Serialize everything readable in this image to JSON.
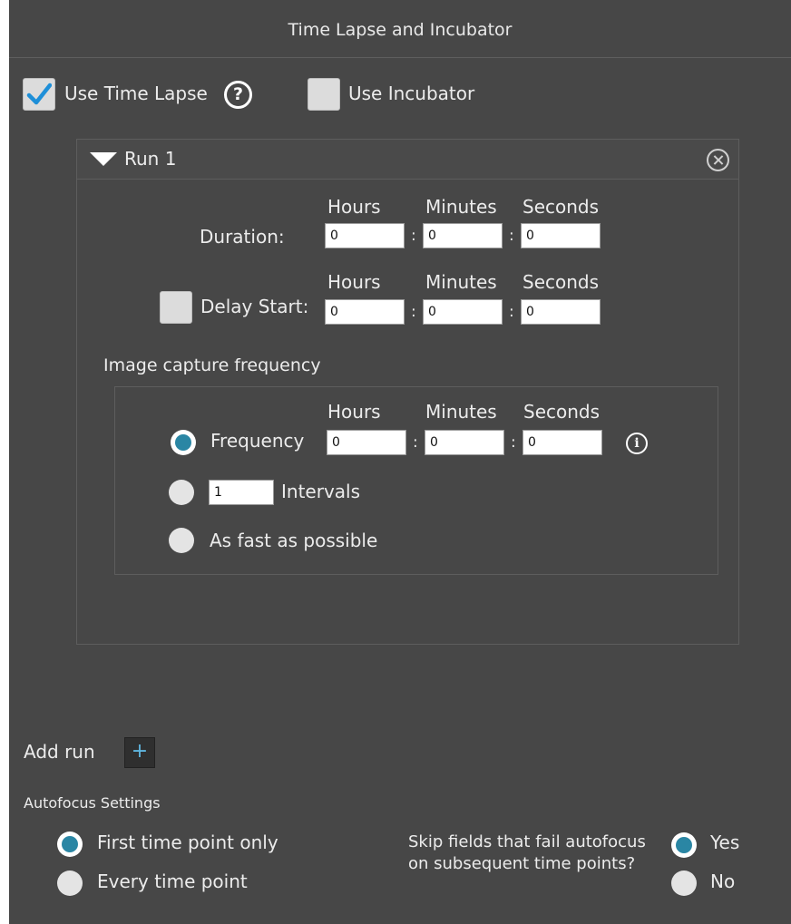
{
  "panel": {
    "title": "Time Lapse and Incubator"
  },
  "options": {
    "use_time_lapse": {
      "label": "Use Time Lapse",
      "checked": true
    },
    "help_icon": "?",
    "use_incubator": {
      "label": "Use Incubator",
      "checked": false
    }
  },
  "run": {
    "title": "Run 1",
    "units": {
      "hours": "Hours",
      "minutes": "Minutes",
      "seconds": "Seconds"
    },
    "duration": {
      "label": "Duration:",
      "hours": "0",
      "minutes": "0",
      "seconds": "0"
    },
    "delay_start": {
      "label": "Delay Start:",
      "checked": false,
      "hours": "0",
      "minutes": "0",
      "seconds": "0"
    },
    "separator": ":",
    "image_capture": {
      "heading": "Image capture frequency",
      "frequency": {
        "label": "Frequency",
        "selected": true,
        "hours": "0",
        "minutes": "0",
        "seconds": "0"
      },
      "info_icon": "i",
      "intervals": {
        "value": "1",
        "label": "Intervals",
        "selected": false
      },
      "fast": {
        "label": "As fast as possible",
        "selected": false
      }
    }
  },
  "add_run": {
    "label": "Add run",
    "button": "+"
  },
  "autofocus": {
    "heading": "Autofocus Settings",
    "first_time_point": {
      "label": "First time point only",
      "selected": true
    },
    "every_time_point": {
      "label": "Every time point",
      "selected": false
    },
    "skip_question": "Skip fields that fail autofocus on subsequent time points?",
    "yes": {
      "label": "Yes",
      "selected": true
    },
    "no": {
      "label": "No",
      "selected": false
    }
  },
  "colors": {
    "panel_bg": "#474747",
    "accent": "#2a86a4",
    "checkmark": "#1e8fd8"
  }
}
